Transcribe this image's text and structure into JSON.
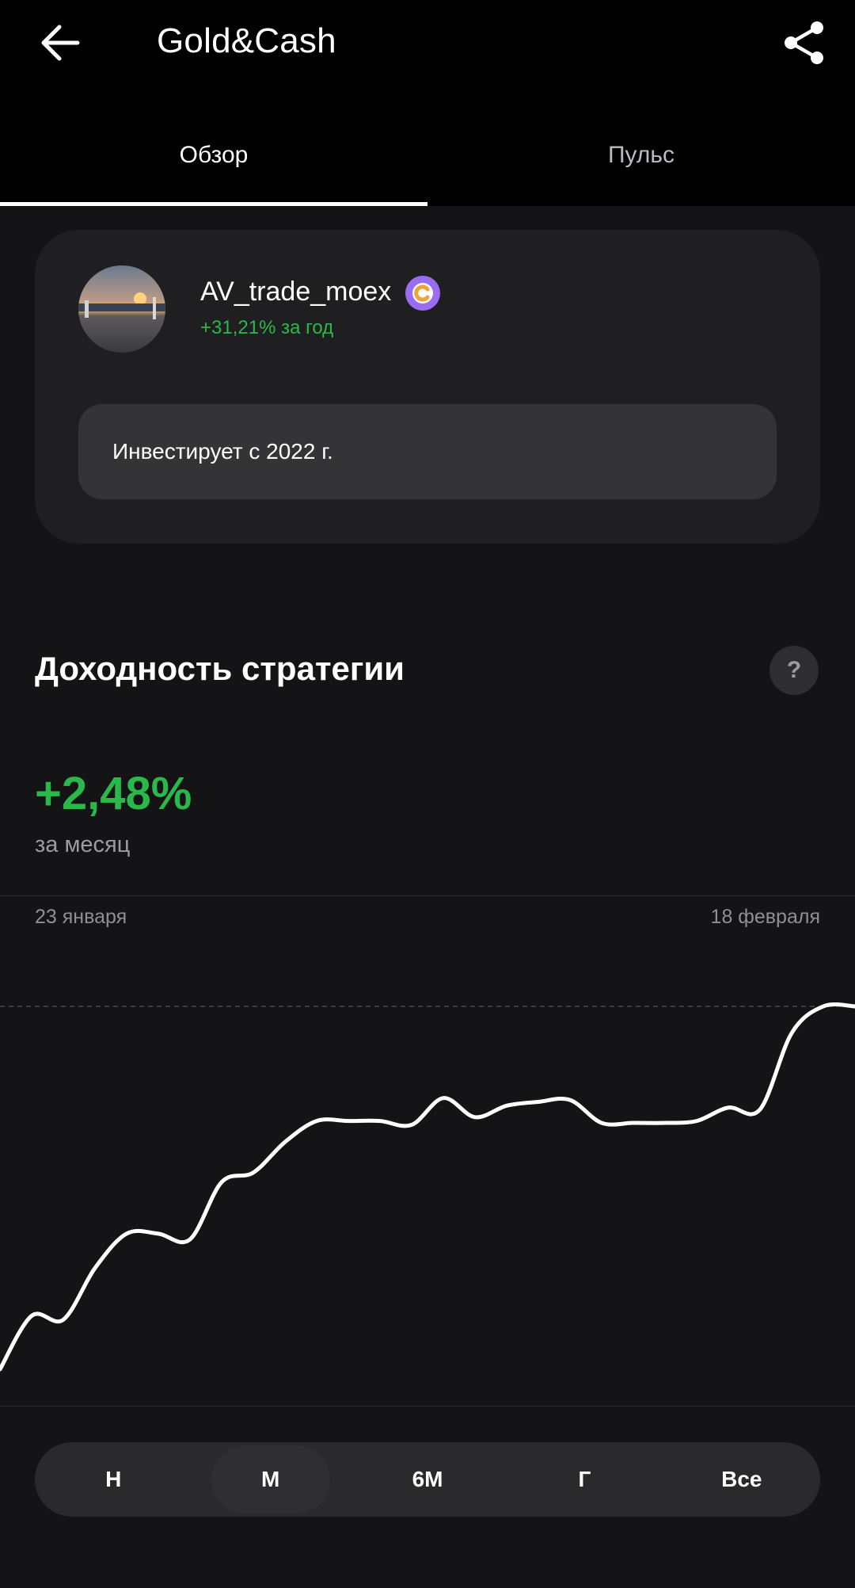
{
  "header": {
    "title": "Gold&Cash",
    "back_icon": "arrow-left-icon",
    "share_icon": "share-icon"
  },
  "tabs": [
    {
      "label": "Обзор",
      "active": true
    },
    {
      "label": "Пульс",
      "active": false
    }
  ],
  "profile": {
    "username": "AV_trade_moex",
    "badge_icon": "verified-badge-icon",
    "year_return": "+31,21% за год",
    "info": "Инвестирует с 2022 г."
  },
  "performance": {
    "title": "Доходность стратегии",
    "help_label": "?",
    "value": "+2,48%",
    "period": "за месяц",
    "date_start": "23 января",
    "date_end": "18 февраля"
  },
  "range_selector": {
    "options": [
      "Н",
      "М",
      "6М",
      "Г",
      "Все"
    ],
    "selected": "М"
  },
  "colors": {
    "positive": "#2bb84a",
    "background": "#141416",
    "card": "#1f1f22",
    "badge": "#9b6cf0"
  },
  "chart_data": {
    "type": "line",
    "x": [
      "23 января",
      "18 февраля"
    ],
    "values": [
      0.0,
      0.28,
      0.26,
      0.53,
      0.71,
      0.71,
      0.68,
      0.98,
      1.03,
      1.19,
      1.3,
      1.3,
      1.3,
      1.28,
      1.42,
      1.32,
      1.38,
      1.4,
      1.41,
      1.29,
      1.29,
      1.29,
      1.3,
      1.37,
      1.36,
      1.76,
      1.9,
      1.9
    ],
    "reference_line": "max",
    "grid": false,
    "series_color": "#ffffff"
  }
}
